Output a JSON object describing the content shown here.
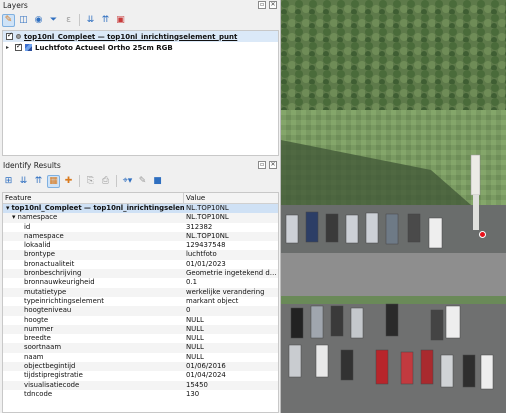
{
  "layers_panel": {
    "title": "Layers",
    "toolbar_icons": [
      "open-layer-styling-icon",
      "add-group-icon",
      "manage-visibility-icon",
      "filter-legend-icon",
      "filter-by-expression-icon",
      "expand-all-icon",
      "collapse-all-icon",
      "remove-layer-icon"
    ],
    "layers": [
      {
        "name": "top10nl_Compleet — top10nl_inrichtingselement_punt",
        "checked": true,
        "selected": true,
        "symbol": "point"
      },
      {
        "name": "Luchtfoto Actueel Ortho 25cm RGB",
        "checked": true,
        "selected": false,
        "symbol": "raster"
      }
    ]
  },
  "identify_panel": {
    "title": "Identify Results",
    "columns": {
      "feature": "Feature",
      "value": "Value"
    },
    "rows": [
      {
        "level": 0,
        "key": "top10nl_Compleet — top10nl_inrichtingselement_punt",
        "value": "NL.TOP10NL",
        "expander": "▾"
      },
      {
        "level": 1,
        "key": "namespace",
        "value": "NL.TOP10NL",
        "expander": "▾"
      },
      {
        "level": 2,
        "key": "id",
        "value": "312382"
      },
      {
        "level": 2,
        "key": "namespace",
        "value": "NL.TOP10NL"
      },
      {
        "level": 2,
        "key": "lokaalid",
        "value": "129437548"
      },
      {
        "level": 2,
        "key": "brontype",
        "value": "luchtfoto"
      },
      {
        "level": 2,
        "key": "bronactualiteit",
        "value": "01/01/2023"
      },
      {
        "level": 2,
        "key": "bronbeschrijving",
        "value": "Geometrie ingetekend doo..."
      },
      {
        "level": 2,
        "key": "bronnauwkeurigheid",
        "value": "0.1"
      },
      {
        "level": 2,
        "key": "mutatietype",
        "value": "werkelijke verandering"
      },
      {
        "level": 2,
        "key": "typeinrichtingselement",
        "value": "markant object"
      },
      {
        "level": 2,
        "key": "hoogteniveau",
        "value": "0"
      },
      {
        "level": 2,
        "key": "hoogte",
        "value": "NULL"
      },
      {
        "level": 2,
        "key": "nummer",
        "value": "NULL"
      },
      {
        "level": 2,
        "key": "breedte",
        "value": "NULL"
      },
      {
        "level": 2,
        "key": "soortnaam",
        "value": "NULL"
      },
      {
        "level": 2,
        "key": "naam",
        "value": "NULL"
      },
      {
        "level": 2,
        "key": "objectbegintijd",
        "value": "01/06/2016"
      },
      {
        "level": 2,
        "key": "tijdstipregistratie",
        "value": "01/04/2024"
      },
      {
        "level": 2,
        "key": "visualisatiecode",
        "value": "15450"
      },
      {
        "level": 2,
        "key": "tdncode",
        "value": "130"
      }
    ]
  },
  "map": {
    "marker_color": "#e8101a"
  }
}
